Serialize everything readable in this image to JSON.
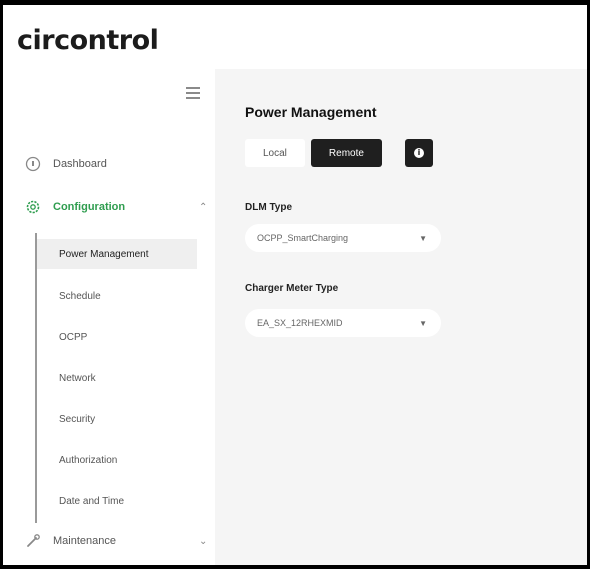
{
  "brand": {
    "logo_text": "circontrol",
    "accent": "#2f9d4f"
  },
  "sidebar": {
    "menu_icon": "hamburger-icon",
    "items": [
      {
        "label": "Dashboard",
        "icon": "dashboard-icon"
      },
      {
        "label": "Configuration",
        "icon": "gear-icon",
        "expanded": true
      },
      {
        "label": "Maintenance",
        "icon": "wrench-icon"
      }
    ],
    "config_sub": [
      "Power Management",
      "Schedule",
      "OCPP",
      "Network",
      "Security",
      "Authorization",
      "Date and Time"
    ],
    "selected_sub": "Power Management"
  },
  "main": {
    "title": "Power Management",
    "toggle": {
      "local": "Local",
      "remote": "Remote",
      "selected": "Remote"
    },
    "info_label": "i",
    "dlm": {
      "label": "DLM Type",
      "value": "OCPP_SmartCharging"
    },
    "meter": {
      "label": "Charger Meter Type",
      "value": "EA_SX_12RHEXMID"
    }
  }
}
